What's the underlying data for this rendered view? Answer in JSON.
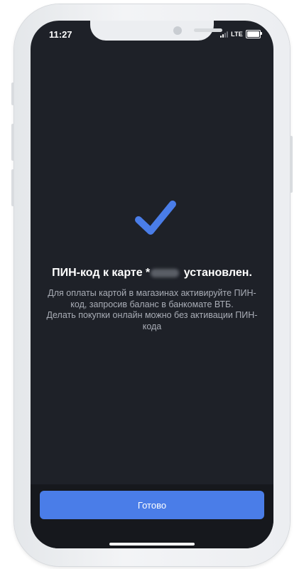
{
  "status_bar": {
    "time": "11:27",
    "network": "LTE"
  },
  "result": {
    "icon": "checkmark-icon",
    "title_prefix": "ПИН-код к карте *",
    "title_suffix": "установлен.",
    "description_lines": [
      "Для оплаты картой в магазинах активируйте ПИН-код, запросив баланс в банкомате ВТБ.",
      "Делать покупки онлайн можно без активации ПИН-кода"
    ]
  },
  "actions": {
    "done_label": "Готово"
  },
  "colors": {
    "background": "#1e2128",
    "accent": "#4a7de8",
    "text_secondary": "#a9adb6"
  }
}
